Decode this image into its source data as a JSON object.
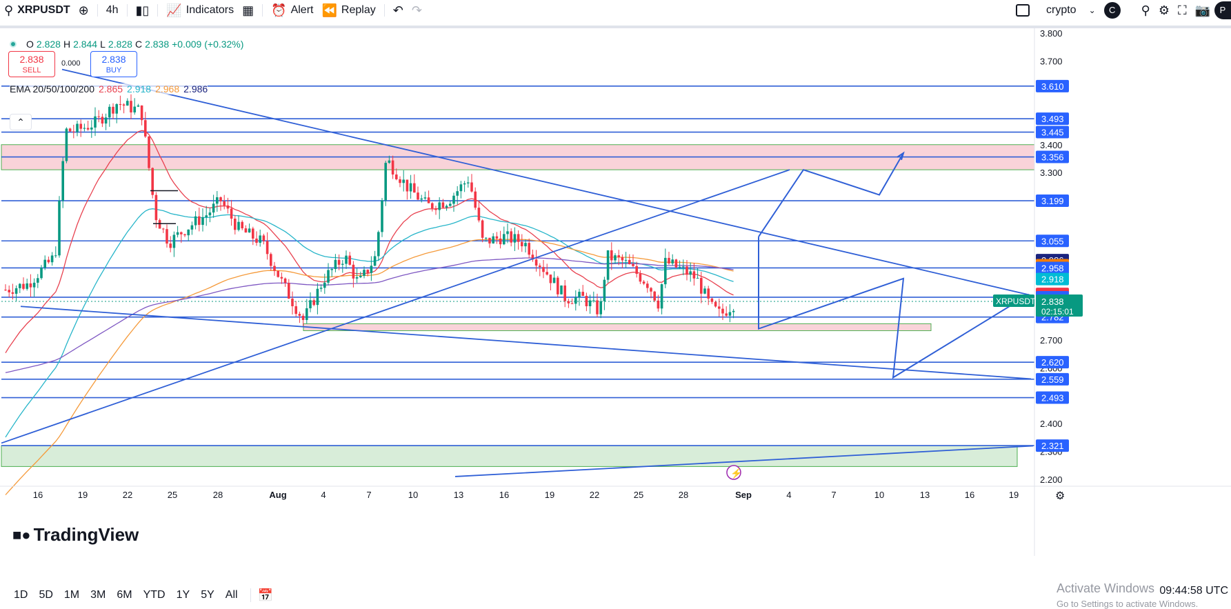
{
  "toolbar": {
    "symbol": "XRPUSDT",
    "interval": "4h",
    "indicators_label": "Indicators",
    "alert_label": "Alert",
    "replay_label": "Replay",
    "layout_name": "crypto",
    "avatar_letter": "C",
    "extra_letter": "P"
  },
  "legend": {
    "open_label": "O",
    "open": "2.828",
    "high_label": "H",
    "high": "2.844",
    "low_label": "L",
    "low": "2.828",
    "close_label": "C",
    "close": "2.838",
    "change": "+0.009 (+0.32%)"
  },
  "trade": {
    "sell_price": "2.838",
    "sell_label": "SELL",
    "buy_price": "2.838",
    "buy_label": "BUY",
    "spread": "0.000"
  },
  "ema": {
    "label": "EMA 20/50/100/200",
    "ema20": "2.865",
    "ema50": "2.918",
    "ema100": "2.968",
    "ema200": "2.986",
    "colors": {
      "ema20": "#e8414f",
      "ema50": "#26b5c9",
      "ema100": "#f59a3a",
      "ema200": "#1a237e"
    }
  },
  "price_axis": {
    "ticks": [
      "3.800",
      "3.700",
      "3.400",
      "3.300",
      "2.700",
      "2.600",
      "2.400",
      "2.300",
      "2.200"
    ],
    "badges": [
      {
        "value": "3.610",
        "color": "#2962ff"
      },
      {
        "value": "3.493",
        "color": "#2962ff"
      },
      {
        "value": "3.445",
        "color": "#2962ff"
      },
      {
        "value": "3.356",
        "color": "#2962ff"
      },
      {
        "value": "3.199",
        "color": "#2962ff"
      },
      {
        "value": "3.055",
        "color": "#2962ff"
      },
      {
        "value": "2.986",
        "color": "#1a237e"
      },
      {
        "value": "2.968",
        "color": "#f57c00"
      },
      {
        "value": "2.958",
        "color": "#2962ff"
      },
      {
        "value": "2.918",
        "color": "#00bcd4"
      },
      {
        "value": "2.865",
        "color": "#f23645"
      },
      {
        "value": "2.853",
        "color": "#2962ff"
      },
      {
        "value": "2.782",
        "color": "#2962ff"
      },
      {
        "value": "2.620",
        "color": "#2962ff"
      },
      {
        "value": "2.559",
        "color": "#2962ff"
      },
      {
        "value": "2.493",
        "color": "#2962ff"
      },
      {
        "value": "2.321",
        "color": "#2962ff"
      }
    ],
    "last_price": "2.838",
    "countdown": "02:15:01",
    "symbol_tag": "XRPUSDT"
  },
  "time_axis": {
    "ticks": [
      "16",
      "19",
      "22",
      "25",
      "28",
      "Aug",
      "4",
      "7",
      "10",
      "13",
      "16",
      "19",
      "22",
      "25",
      "28",
      "Sep",
      "4",
      "7",
      "10",
      "13",
      "16",
      "19"
    ]
  },
  "bottom": {
    "timeframes": [
      "1D",
      "5D",
      "1M",
      "3M",
      "6M",
      "YTD",
      "1Y",
      "5Y",
      "All"
    ],
    "clock": "09:44:58 UTC",
    "watermark_line1": "Activate Windows",
    "watermark_line2": "Go to Settings to activate Windows."
  },
  "logo_text": "TradingView",
  "colors": {
    "bull": "#089981",
    "bear": "#f23645",
    "line_blue": "#2962ff",
    "drawing_blue": "#2f5fd6"
  }
}
